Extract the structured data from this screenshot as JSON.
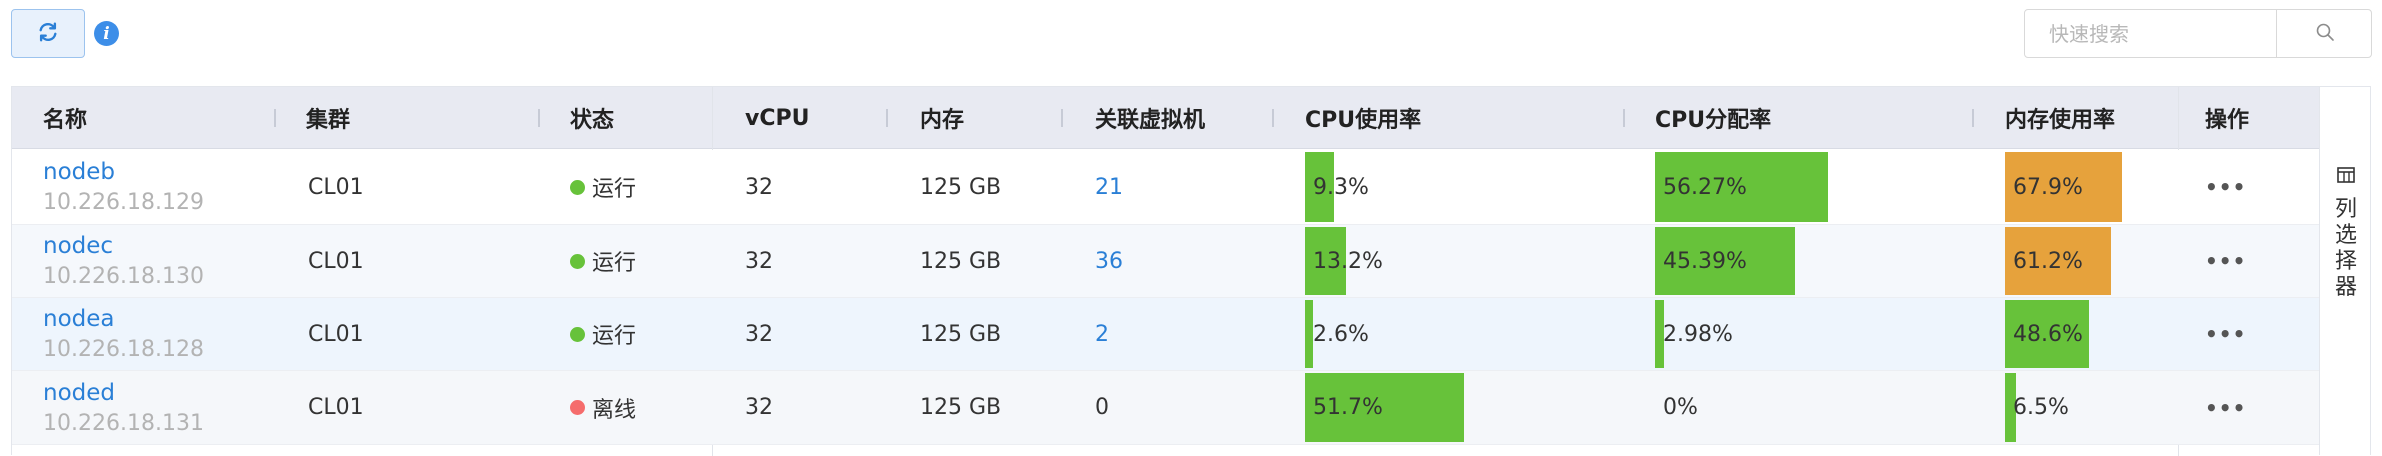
{
  "toolbar": {
    "refresh_icon": "refresh-icon",
    "info_icon": "info-icon",
    "info_glyph": "i",
    "search_placeholder": "快速搜索",
    "search_icon": "search-icon"
  },
  "table": {
    "columns": [
      "名称",
      "集群",
      "状态",
      "vCPU",
      "内存",
      "关联虚拟机",
      "CPU使用率",
      "CPU分配率",
      "内存使用率",
      "操作"
    ],
    "rows": [
      {
        "name": "nodeb",
        "ip": "10.226.18.129",
        "cluster": "CL01",
        "status": "运行",
        "status_color": "#67c23a",
        "vcpu": "32",
        "memory": "125 GB",
        "vms": "21",
        "vms_link": true,
        "cpu_usage": "9.3%",
        "cpu_usage_value": 9.3,
        "cpu_alloc": "56.27%",
        "cpu_alloc_value": 56.27,
        "mem_usage": "67.9%",
        "mem_usage_value": 67.9,
        "mem_color": "#e6a23c",
        "actions": "•••"
      },
      {
        "name": "nodec",
        "ip": "10.226.18.130",
        "cluster": "CL01",
        "status": "运行",
        "status_color": "#67c23a",
        "vcpu": "32",
        "memory": "125 GB",
        "vms": "36",
        "vms_link": true,
        "cpu_usage": "13.2%",
        "cpu_usage_value": 13.2,
        "cpu_alloc": "45.39%",
        "cpu_alloc_value": 45.39,
        "mem_usage": "61.2%",
        "mem_usage_value": 61.2,
        "mem_color": "#e6a23c",
        "actions": "•••"
      },
      {
        "name": "nodea",
        "ip": "10.226.18.128",
        "cluster": "CL01",
        "status": "运行",
        "status_color": "#67c23a",
        "vcpu": "32",
        "memory": "125 GB",
        "vms": "2",
        "vms_link": true,
        "cpu_usage": "2.6%",
        "cpu_usage_value": 2.6,
        "cpu_alloc": "2.98%",
        "cpu_alloc_value": 2.98,
        "mem_usage": "48.6%",
        "mem_usage_value": 48.6,
        "mem_color": "#67c23a",
        "actions": "•••"
      },
      {
        "name": "noded",
        "ip": "10.226.18.131",
        "cluster": "CL01",
        "status": "离线",
        "status_color": "#f56c6c",
        "vcpu": "32",
        "memory": "125 GB",
        "vms": "0",
        "vms_link": false,
        "cpu_usage": "51.7%",
        "cpu_usage_value": 51.7,
        "cpu_alloc": "0%",
        "cpu_alloc_value": 0,
        "mem_usage": "6.5%",
        "mem_usage_value": 6.5,
        "mem_color": "#67c23a",
        "actions": "•••"
      }
    ]
  },
  "column_selector": {
    "icon": "columns-icon",
    "label": "列选择器"
  },
  "colors": {
    "accent": "#2a7fd6",
    "bar_green": "#67c23a",
    "bar_orange": "#e6a23c",
    "header_bg": "#e8eaf2"
  }
}
